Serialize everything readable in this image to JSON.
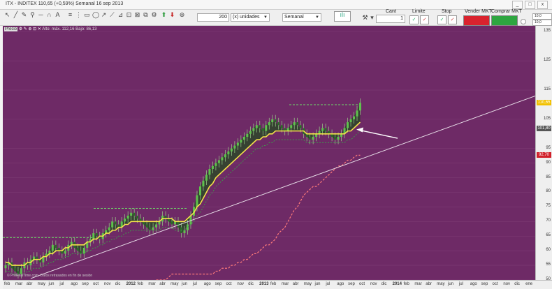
{
  "window": {
    "title_symbol": "ITX - INDITEX",
    "title_change": "110,65 (+0,59%)",
    "title_period": "Semanal",
    "title_date": "16 sep 2013",
    "minimize": "_",
    "maximize": "□",
    "close": "x"
  },
  "toolbar": {
    "quantity_value": "200",
    "quantity_unit": "(x) unidades",
    "period_value": "Semanal",
    "cant_label": "Cant",
    "cant_value": "1",
    "limite_label": "Limite",
    "stop_label": "Stop",
    "sell_label": "Vender MKT",
    "buy_label": "Comprar MKT",
    "right_field_1": "10,0",
    "right_field_2": "10,0"
  },
  "chart_header": {
    "label": "Precio",
    "info": "Alto: máx. 112,16  Bajo: 86,13"
  },
  "chart_data": {
    "type": "candlestick",
    "ylim": [
      50,
      137
    ],
    "yticks": [
      "135",
      "125",
      "115",
      "105",
      "95",
      "90",
      "85",
      "80",
      "75",
      "70",
      "65",
      "60",
      "55",
      "50"
    ],
    "ytick_values": [
      135,
      125,
      115,
      105,
      95,
      90,
      85,
      80,
      75,
      70,
      65,
      60,
      55,
      50
    ],
    "price_tags": [
      {
        "label": "110,65",
        "value": 110.65,
        "color": "#f2c100"
      },
      {
        "label": "101,80",
        "value": 101.8,
        "color": "#555555"
      },
      {
        "label": "92,70",
        "value": 92.7,
        "color": "#d1202a"
      }
    ],
    "xticks": [
      "feb",
      "mar",
      "abr",
      "may",
      "jun",
      "jul",
      "ago",
      "sep",
      "oct",
      "nov",
      "dic",
      "2012",
      "feb",
      "mar",
      "abr",
      "may",
      "jun",
      "jul",
      "ago",
      "sep",
      "oct",
      "nov",
      "dic",
      "2013",
      "feb",
      "mar",
      "abr",
      "may",
      "jun",
      "jul",
      "ago",
      "sep",
      "oct",
      "nov",
      "dic",
      "2014",
      "feb",
      "mar",
      "abr",
      "may",
      "jun",
      "jul",
      "ago",
      "sep",
      "oct",
      "nov",
      "dic",
      "ene"
    ],
    "year_ticks": [
      "2012",
      "2013",
      "2014"
    ],
    "watermark": "© ProRealTime.com. Datos retrasados en fin de sesión",
    "close_series": [
      55,
      56,
      54,
      53,
      52,
      54,
      56,
      55,
      57,
      58,
      57,
      56,
      58,
      59,
      60,
      62,
      61,
      60,
      59,
      60,
      62,
      63,
      61,
      60,
      59,
      61,
      63,
      64,
      66,
      65,
      64,
      66,
      67,
      68,
      70,
      69,
      68,
      70,
      71,
      72,
      73,
      72,
      71,
      70,
      69,
      68,
      67,
      68,
      69,
      70,
      72,
      71,
      70,
      69,
      70,
      68,
      66,
      67,
      69,
      72,
      75,
      79,
      82,
      84,
      86,
      88,
      89,
      90,
      91,
      92,
      93,
      94,
      95,
      96,
      97,
      98,
      99,
      100,
      101,
      102,
      103,
      102,
      101,
      103,
      104,
      105,
      104,
      103,
      102,
      101,
      102,
      103,
      104,
      103,
      102,
      100,
      99,
      98,
      99,
      100,
      101,
      102,
      101,
      100,
      99,
      98,
      99,
      100,
      102,
      104,
      105,
      106,
      108,
      110.65
    ],
    "moving_avg_series": [
      56,
      56,
      55,
      55,
      55,
      55,
      55,
      56,
      56,
      57,
      57,
      57,
      58,
      58,
      59,
      59,
      60,
      60,
      60,
      61,
      61,
      62,
      62,
      62,
      62,
      62,
      63,
      63,
      64,
      64,
      65,
      65,
      66,
      66,
      67,
      67,
      68,
      68,
      69,
      69,
      70,
      70,
      70,
      70,
      70,
      70,
      70,
      70,
      70,
      70,
      71,
      71,
      71,
      71,
      70,
      70,
      70,
      70,
      71,
      72,
      73,
      75,
      76,
      78,
      80,
      82,
      83,
      85,
      86,
      87,
      88,
      89,
      90,
      91,
      92,
      93,
      94,
      95,
      96,
      97,
      98,
      98,
      99,
      99,
      100,
      100,
      101,
      101,
      101,
      101,
      101,
      101,
      101,
      101,
      101,
      101,
      100,
      100,
      100,
      100,
      100,
      100,
      100,
      100,
      100,
      100,
      100,
      100,
      100,
      101,
      101,
      102,
      103,
      104
    ],
    "stop_series": [
      null,
      null,
      null,
      null,
      null,
      null,
      null,
      null,
      null,
      null,
      null,
      null,
      null,
      null,
      null,
      null,
      null,
      null,
      null,
      null,
      null,
      null,
      null,
      null,
      null,
      null,
      null,
      null,
      null,
      null,
      null,
      null,
      null,
      null,
      null,
      null,
      null,
      null,
      null,
      null,
      null,
      null,
      null,
      null,
      null,
      null,
      null,
      null,
      50,
      50,
      50,
      50,
      51,
      52,
      52,
      52,
      52,
      52,
      52,
      52,
      52,
      52,
      52,
      52,
      52,
      52,
      52,
      53,
      53,
      54,
      54,
      54,
      55,
      55,
      56,
      56,
      57,
      57,
      58,
      59,
      59,
      60,
      61,
      62,
      62,
      63,
      64,
      66,
      67,
      68,
      70,
      72,
      74,
      75,
      77,
      79,
      80,
      81,
      82,
      82,
      83,
      84,
      85,
      86,
      87,
      88,
      89,
      89,
      90,
      91,
      91,
      92,
      92.7,
      92.7
    ],
    "annotations": [
      "trend-line",
      "arrow-to-price"
    ]
  }
}
